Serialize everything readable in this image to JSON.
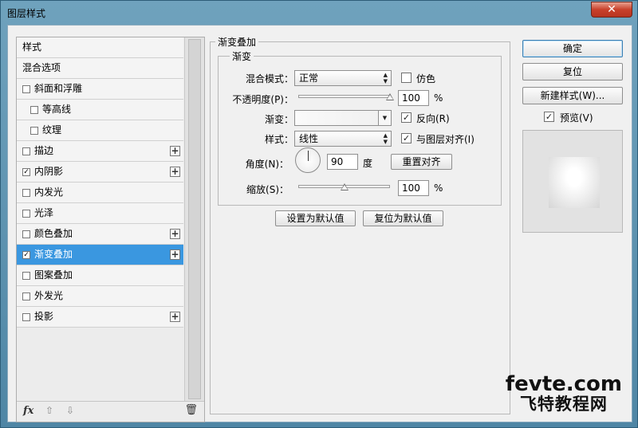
{
  "window": {
    "title": "图层样式",
    "close_symbol": "✕"
  },
  "styles_panel": {
    "header": "样式",
    "blend_options": "混合选项",
    "items": [
      {
        "label": "斜面和浮雕",
        "checked": false,
        "has_add": false,
        "indent": 0
      },
      {
        "label": "等高线",
        "checked": false,
        "has_add": false,
        "indent": 1
      },
      {
        "label": "纹理",
        "checked": false,
        "has_add": false,
        "indent": 1
      },
      {
        "label": "描边",
        "checked": false,
        "has_add": true,
        "indent": 0
      },
      {
        "label": "内阴影",
        "checked": true,
        "has_add": true,
        "indent": 0
      },
      {
        "label": "内发光",
        "checked": false,
        "has_add": false,
        "indent": 0
      },
      {
        "label": "光泽",
        "checked": false,
        "has_add": false,
        "indent": 0
      },
      {
        "label": "颜色叠加",
        "checked": false,
        "has_add": true,
        "indent": 0
      },
      {
        "label": "渐变叠加",
        "checked": true,
        "has_add": true,
        "indent": 0,
        "selected": true
      },
      {
        "label": "图案叠加",
        "checked": false,
        "has_add": false,
        "indent": 0
      },
      {
        "label": "外发光",
        "checked": false,
        "has_add": false,
        "indent": 0
      },
      {
        "label": "投影",
        "checked": false,
        "has_add": true,
        "indent": 0
      }
    ],
    "footer": {
      "fx": "fx",
      "up": "⇧",
      "down": "⇩",
      "trash": "🗑"
    }
  },
  "gradient_overlay": {
    "group_title": "渐变叠加",
    "sub_title": "渐变",
    "blend_mode_label": "混合模式：",
    "blend_mode_value": "正常",
    "dither_label": "仿色",
    "dither_checked": false,
    "opacity_label": "不透明度(P)：",
    "opacity_value": "100",
    "opacity_fraction": 1.0,
    "percent": "%",
    "gradient_label": "渐变：",
    "reverse_label": "反向(R)",
    "reverse_checked": true,
    "style_label": "样式：",
    "style_value": "线性",
    "align_label": "与图层对齐(I)",
    "align_checked": true,
    "angle_label": "角度(N)：",
    "angle_value": "90",
    "angle_unit": "度",
    "realign_button": "重置对齐",
    "scale_label": "缩放(S)：",
    "scale_value": "100",
    "scale_fraction": 0.5,
    "set_default_button": "设置为默认值",
    "reset_default_button": "复位为默认值"
  },
  "right_column": {
    "ok_button": "确定",
    "reset_button": "复位",
    "new_style_button": "新建样式(W)...",
    "preview_label": "预览(V)",
    "preview_checked": true
  },
  "watermark": {
    "top": "fevte.com",
    "bottom": "飞特教程网"
  }
}
